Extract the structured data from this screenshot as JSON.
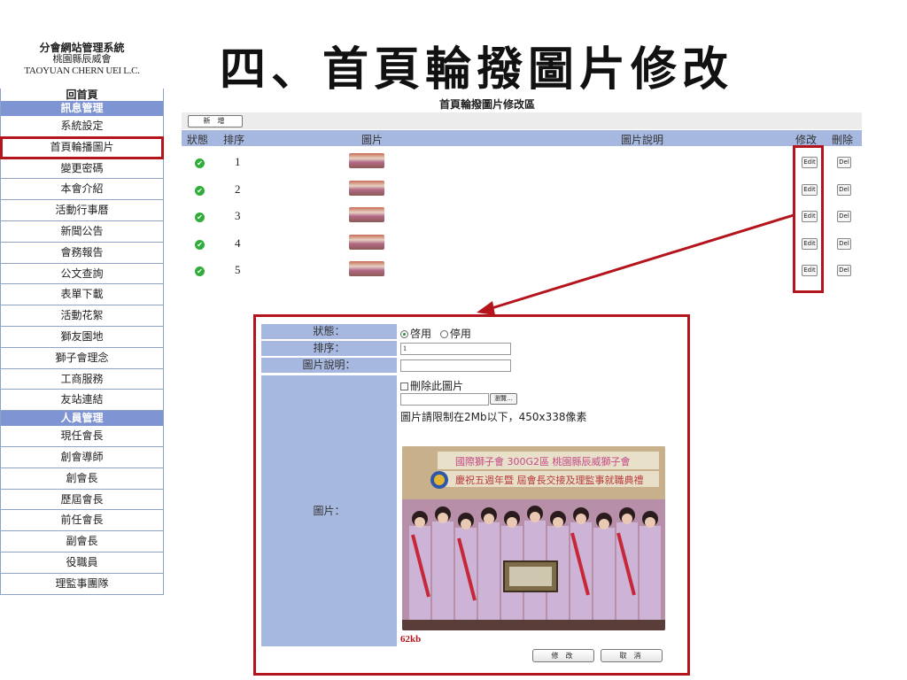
{
  "slide_title": "四、首頁輪撥圖片修改",
  "sidebar": {
    "title": "分會網站管理系統",
    "org": "桃園縣辰威會",
    "org_en": "TAOYUAN CHERN UEI L.C.",
    "items": [
      {
        "label": "回首頁",
        "kind": "home"
      },
      {
        "label": "訊息管理",
        "kind": "section"
      },
      {
        "label": "系統設定",
        "kind": "item"
      },
      {
        "label": "首頁輪播圖片",
        "kind": "active"
      },
      {
        "label": "變更密碼",
        "kind": "item"
      },
      {
        "label": "本會介紹",
        "kind": "item"
      },
      {
        "label": "活動行事曆",
        "kind": "item"
      },
      {
        "label": "新聞公告",
        "kind": "item"
      },
      {
        "label": "會務報告",
        "kind": "item"
      },
      {
        "label": "公文查詢",
        "kind": "item"
      },
      {
        "label": "表單下載",
        "kind": "item"
      },
      {
        "label": "活動花絮",
        "kind": "item"
      },
      {
        "label": "獅友園地",
        "kind": "item"
      },
      {
        "label": "獅子會理念",
        "kind": "item"
      },
      {
        "label": "工商服務",
        "kind": "item"
      },
      {
        "label": "友站連結",
        "kind": "item"
      },
      {
        "label": "人員管理",
        "kind": "section"
      },
      {
        "label": "現任會長",
        "kind": "item"
      },
      {
        "label": "創會導師",
        "kind": "item"
      },
      {
        "label": "創會長",
        "kind": "item"
      },
      {
        "label": "歷屆會長",
        "kind": "item"
      },
      {
        "label": "前任會長",
        "kind": "item"
      },
      {
        "label": "副會長",
        "kind": "item"
      },
      {
        "label": "役職員",
        "kind": "item"
      },
      {
        "label": "理監事團隊",
        "kind": "item"
      }
    ]
  },
  "list": {
    "title": "首頁輪撥圖片修改區",
    "add_label": "新 增",
    "columns": {
      "status": "狀態",
      "order": "排序",
      "image": "圖片",
      "desc": "圖片說明",
      "edit": "修改",
      "delete": "刪除"
    },
    "rows": [
      {
        "status_icon": "check-icon",
        "order": "1",
        "edit_label": "Edit",
        "del_label": "Del"
      },
      {
        "status_icon": "check-icon",
        "order": "2",
        "edit_label": "Edit",
        "del_label": "Del"
      },
      {
        "status_icon": "check-icon",
        "order": "3",
        "edit_label": "Edit",
        "del_label": "Del"
      },
      {
        "status_icon": "check-icon",
        "order": "4",
        "edit_label": "Edit",
        "del_label": "Del"
      },
      {
        "status_icon": "check-icon",
        "order": "5",
        "edit_label": "Edit",
        "del_label": "Del"
      }
    ]
  },
  "form": {
    "status_label": "狀態：",
    "status_on": "啓用",
    "status_off": "停用",
    "order_label": "排序：",
    "order_value": "1",
    "desc_label": "圖片說明：",
    "desc_value": "",
    "delete_image_label": "刪除此圖片",
    "browse_label": "瀏覽...",
    "size_hint": "圖片請限制在2Mb以下，450x338像素",
    "image_label": "圖片：",
    "photo_banner_1": "國際獅子會 300G2區 桃園縣辰威獅子會",
    "photo_banner_2": "慶祝五週年暨 屆會長交接及理監事就職典禮",
    "file_size": "62kb",
    "save_label": "修 改",
    "cancel_label": "取 消"
  },
  "colors": {
    "accent_red": "#b4141b",
    "header_blue": "#a7b8e0",
    "section_blue": "#7f95d3",
    "status_green": "#2fae3b"
  }
}
